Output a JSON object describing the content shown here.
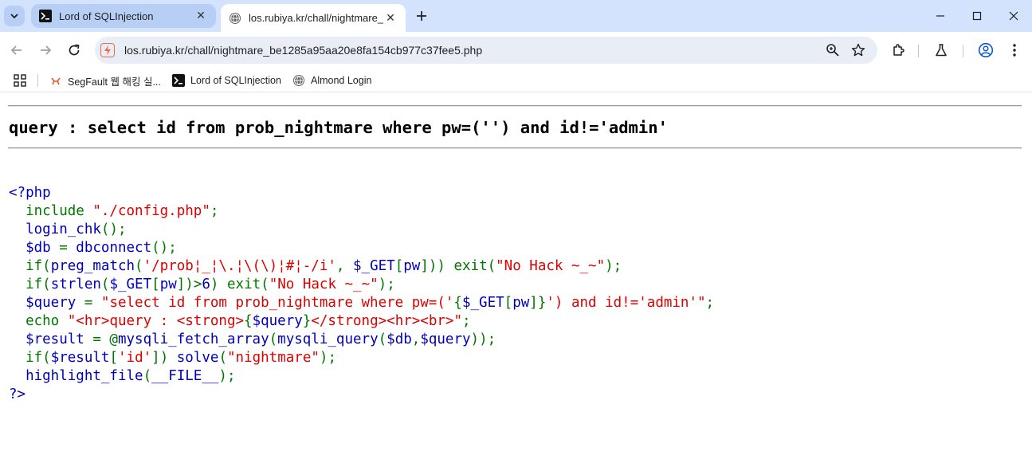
{
  "browser": {
    "tabs": [
      {
        "title": "Lord of SQLInjection",
        "icon": "terminal-icon",
        "active": false
      },
      {
        "title": "los.rubiya.kr/chall/nightmare_b",
        "icon": "globe-icon",
        "active": true
      }
    ],
    "url": "los.rubiya.kr/chall/nightmare_be1285a95aa20e8fa154cb977c37fee5.php",
    "bookmarks": [
      {
        "label": "SegFault 웹 해킹 실...",
        "icon": "segfault-icon"
      },
      {
        "label": "Lord of SQLInjection",
        "icon": "terminal-icon"
      },
      {
        "label": "Almond Login",
        "icon": "globe-icon"
      }
    ]
  },
  "page": {
    "query": "query : select id from prob_nightmare where pw=('') and id!='admin'",
    "code_lines": [
      [
        {
          "c": "default",
          "t": "<?php"
        }
      ],
      [
        {
          "c": "keyword",
          "t": "  include "
        },
        {
          "c": "string",
          "t": "\"./config.php\""
        },
        {
          "c": "keyword",
          "t": ";"
        }
      ],
      [
        {
          "c": "default",
          "t": "  login_chk"
        },
        {
          "c": "keyword",
          "t": "();"
        }
      ],
      [
        {
          "c": "default",
          "t": "  $db "
        },
        {
          "c": "keyword",
          "t": "= "
        },
        {
          "c": "default",
          "t": "dbconnect"
        },
        {
          "c": "keyword",
          "t": "();"
        }
      ],
      [
        {
          "c": "keyword",
          "t": "  if("
        },
        {
          "c": "default",
          "t": "preg_match"
        },
        {
          "c": "keyword",
          "t": "("
        },
        {
          "c": "string",
          "t": "'/prob¦_¦\\.¦\\(\\)¦#¦-/i'"
        },
        {
          "c": "keyword",
          "t": ", "
        },
        {
          "c": "default",
          "t": "$_GET"
        },
        {
          "c": "keyword",
          "t": "["
        },
        {
          "c": "default",
          "t": "pw"
        },
        {
          "c": "keyword",
          "t": "])) exit("
        },
        {
          "c": "string",
          "t": "\"No Hack ~_~\""
        },
        {
          "c": "keyword",
          "t": ");"
        }
      ],
      [
        {
          "c": "keyword",
          "t": "  if("
        },
        {
          "c": "default",
          "t": "strlen"
        },
        {
          "c": "keyword",
          "t": "("
        },
        {
          "c": "default",
          "t": "$_GET"
        },
        {
          "c": "keyword",
          "t": "["
        },
        {
          "c": "default",
          "t": "pw"
        },
        {
          "c": "keyword",
          "t": "])>"
        },
        {
          "c": "default",
          "t": "6"
        },
        {
          "c": "keyword",
          "t": ") exit("
        },
        {
          "c": "string",
          "t": "\"No Hack ~_~\""
        },
        {
          "c": "keyword",
          "t": ");"
        }
      ],
      [
        {
          "c": "default",
          "t": "  $query "
        },
        {
          "c": "keyword",
          "t": "= "
        },
        {
          "c": "string",
          "t": "\"select id from prob_nightmare where pw=('"
        },
        {
          "c": "keyword",
          "t": "{"
        },
        {
          "c": "default",
          "t": "$_GET"
        },
        {
          "c": "keyword",
          "t": "["
        },
        {
          "c": "default",
          "t": "pw"
        },
        {
          "c": "keyword",
          "t": "]}"
        },
        {
          "c": "string",
          "t": "') and id!='admin'\""
        },
        {
          "c": "keyword",
          "t": ";"
        }
      ],
      [
        {
          "c": "keyword",
          "t": "  echo "
        },
        {
          "c": "string",
          "t": "\"<hr>query : <strong>"
        },
        {
          "c": "keyword",
          "t": "{"
        },
        {
          "c": "default",
          "t": "$query"
        },
        {
          "c": "keyword",
          "t": "}"
        },
        {
          "c": "string",
          "t": "</strong><hr><br>\""
        },
        {
          "c": "keyword",
          "t": ";"
        }
      ],
      [
        {
          "c": "default",
          "t": "  $result "
        },
        {
          "c": "keyword",
          "t": "= @"
        },
        {
          "c": "default",
          "t": "mysqli_fetch_array"
        },
        {
          "c": "keyword",
          "t": "("
        },
        {
          "c": "default",
          "t": "mysqli_query"
        },
        {
          "c": "keyword",
          "t": "("
        },
        {
          "c": "default",
          "t": "$db"
        },
        {
          "c": "keyword",
          "t": ","
        },
        {
          "c": "default",
          "t": "$query"
        },
        {
          "c": "keyword",
          "t": "));"
        }
      ],
      [
        {
          "c": "keyword",
          "t": "  if("
        },
        {
          "c": "default",
          "t": "$result"
        },
        {
          "c": "keyword",
          "t": "["
        },
        {
          "c": "string",
          "t": "'id'"
        },
        {
          "c": "keyword",
          "t": "]) "
        },
        {
          "c": "default",
          "t": "solve"
        },
        {
          "c": "keyword",
          "t": "("
        },
        {
          "c": "string",
          "t": "\"nightmare\""
        },
        {
          "c": "keyword",
          "t": ");"
        }
      ],
      [
        {
          "c": "default",
          "t": "  highlight_file"
        },
        {
          "c": "keyword",
          "t": "("
        },
        {
          "c": "default",
          "t": "__FILE__"
        },
        {
          "c": "keyword",
          "t": ");"
        }
      ],
      [
        {
          "c": "default",
          "t": "?>"
        }
      ]
    ]
  },
  "colors": {
    "default": "#0000bb",
    "keyword": "#007700",
    "string": "#dd0000",
    "tabstrip": "#d3e3fd"
  }
}
